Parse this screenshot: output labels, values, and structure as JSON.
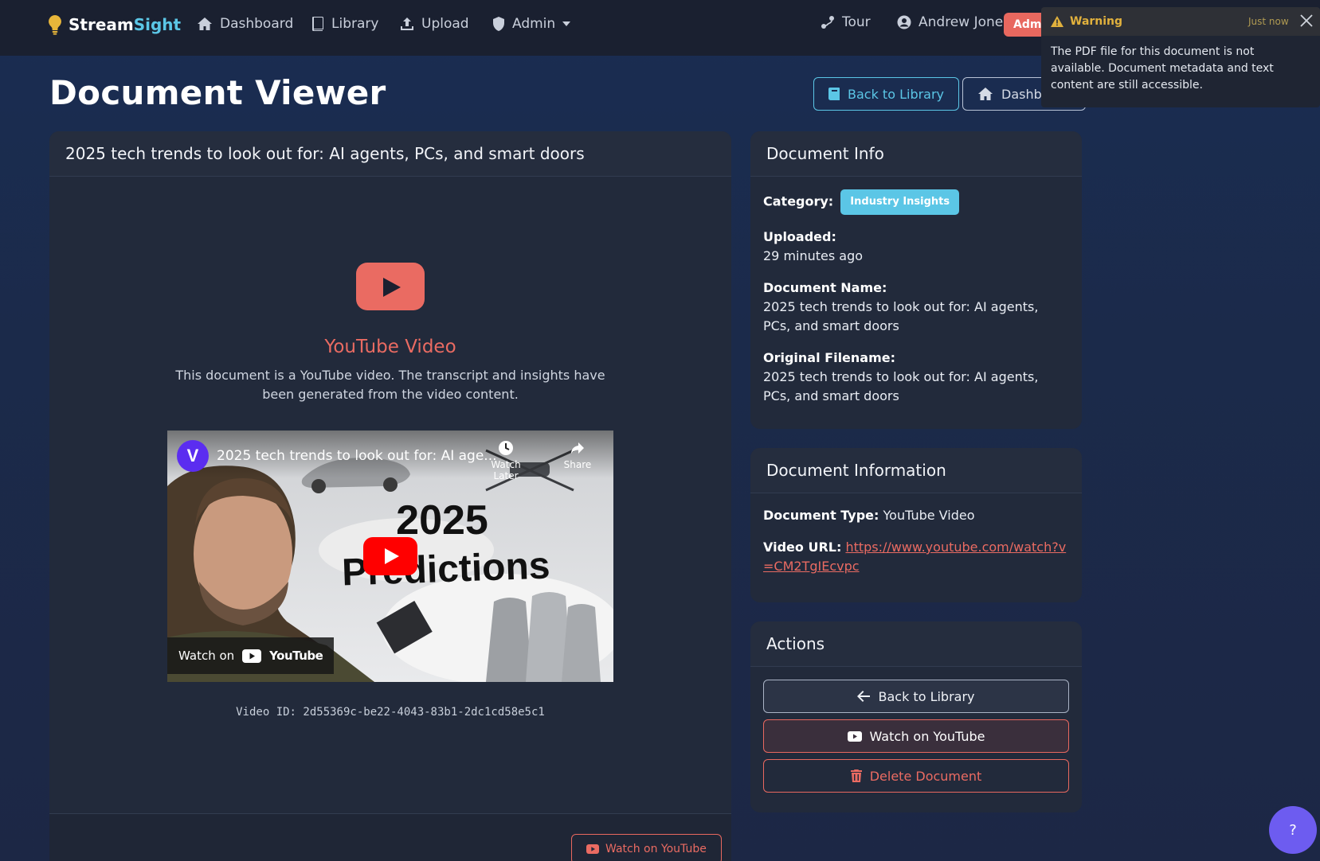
{
  "brand": {
    "part1": "Stream",
    "part2": "Sight"
  },
  "nav": {
    "dashboard": "Dashboard",
    "library": "Library",
    "upload": "Upload",
    "admin": "Admin",
    "tour": "Tour",
    "user": "Andrew Jones",
    "admin_badge": "Admin"
  },
  "page": {
    "title": "Document Viewer",
    "back_to_library": "Back to Library",
    "dashboard": "Dashboard"
  },
  "document": {
    "title": "2025 tech trends to look out for: AI agents, PCs, and smart doors",
    "media_title": "YouTube Video",
    "media_desc": "This document is a YouTube video. The transcript and insights have been generated from the video content.",
    "video_id": "Video ID: 2d55369c-be22-4043-83b1-2dc1cd58e5c1",
    "footer_button": "Watch on YouTube"
  },
  "video_embed": {
    "title": "2025 tech trends to look out for: AI age...",
    "watch_later": "Watch Later",
    "share": "Share",
    "watch_on": "Watch on",
    "youtube": "YouTube",
    "headline_1": "2025",
    "headline_2": "Predictions"
  },
  "doc_info": {
    "header": "Document Info",
    "category_label": "Category:",
    "category_value": "Industry Insights",
    "uploaded_label": "Uploaded:",
    "uploaded_value": "29 minutes ago",
    "name_label": "Document Name:",
    "name_value": "2025 tech trends to look out for: AI agents, PCs, and smart doors",
    "orig_label": "Original Filename:",
    "orig_value": "2025 tech trends to look out for: AI agents, PCs, and smart doors"
  },
  "doc_information": {
    "header": "Document Information",
    "type_label": "Document Type:",
    "type_value": "YouTube Video",
    "url_label": "Video URL:",
    "url_value": "https://www.youtube.com/watch?v=CM2TgIEcvpc"
  },
  "actions": {
    "header": "Actions",
    "back": "Back to Library",
    "youtube": "Watch on YouTube",
    "delete": "Delete Document"
  },
  "toast": {
    "title": "Warning",
    "time": "Just now",
    "message": "The PDF file for this document is not available. Document metadata and text content are still accessible."
  },
  "help": {
    "label": "?"
  },
  "colors": {
    "accent": "#5bc6e6",
    "danger": "#ea6b62",
    "warning": "#e1b13d",
    "help": "#6d5cf0"
  }
}
